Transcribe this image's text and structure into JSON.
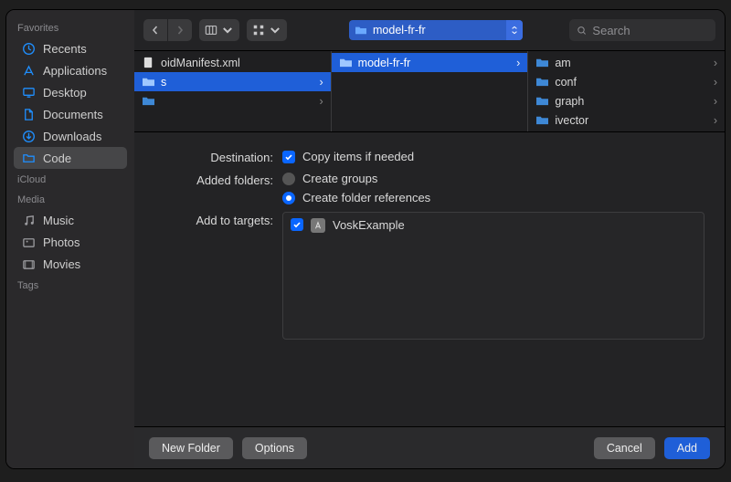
{
  "sidebar": {
    "groups": [
      {
        "label": "Favorites",
        "items": [
          {
            "label": "Recents",
            "icon": "clock-icon"
          },
          {
            "label": "Applications",
            "icon": "apps-icon"
          },
          {
            "label": "Desktop",
            "icon": "desktop-icon"
          },
          {
            "label": "Documents",
            "icon": "documents-icon"
          },
          {
            "label": "Downloads",
            "icon": "downloads-icon"
          },
          {
            "label": "Code",
            "icon": "folder-icon",
            "selected": true
          }
        ]
      },
      {
        "label": "iCloud",
        "items": []
      },
      {
        "label": "Media",
        "items": [
          {
            "label": "Music",
            "icon": "music-icon"
          },
          {
            "label": "Photos",
            "icon": "photos-icon"
          },
          {
            "label": "Movies",
            "icon": "movies-icon"
          }
        ]
      },
      {
        "label": "Tags",
        "items": []
      }
    ]
  },
  "toolbar": {
    "path_label": "model-fr-fr",
    "search_placeholder": "Search"
  },
  "columns": [
    {
      "items": [
        {
          "label": "oidManifest.xml",
          "type": "file",
          "chevron": false
        },
        {
          "label": "s",
          "type": "folder-open",
          "chevron": true,
          "selected": true
        },
        {
          "label": "",
          "type": "folder",
          "chevron": true
        }
      ]
    },
    {
      "items": [
        {
          "label": "model-fr-fr",
          "type": "folder-open",
          "chevron": true,
          "selected": true
        }
      ]
    },
    {
      "items": [
        {
          "label": "am",
          "type": "folder",
          "chevron": true
        },
        {
          "label": "conf",
          "type": "folder",
          "chevron": true
        },
        {
          "label": "graph",
          "type": "folder",
          "chevron": true
        },
        {
          "label": "ivector",
          "type": "folder",
          "chevron": true
        }
      ]
    }
  ],
  "form": {
    "destination_label": "Destination:",
    "copy_items_label": "Copy items if needed",
    "added_folders_label": "Added folders:",
    "create_groups_label": "Create groups",
    "create_folder_refs_label": "Create folder references",
    "add_to_targets_label": "Add to targets:",
    "target_name": "VoskExample"
  },
  "bottom": {
    "new_folder": "New Folder",
    "options": "Options",
    "cancel": "Cancel",
    "add": "Add"
  }
}
